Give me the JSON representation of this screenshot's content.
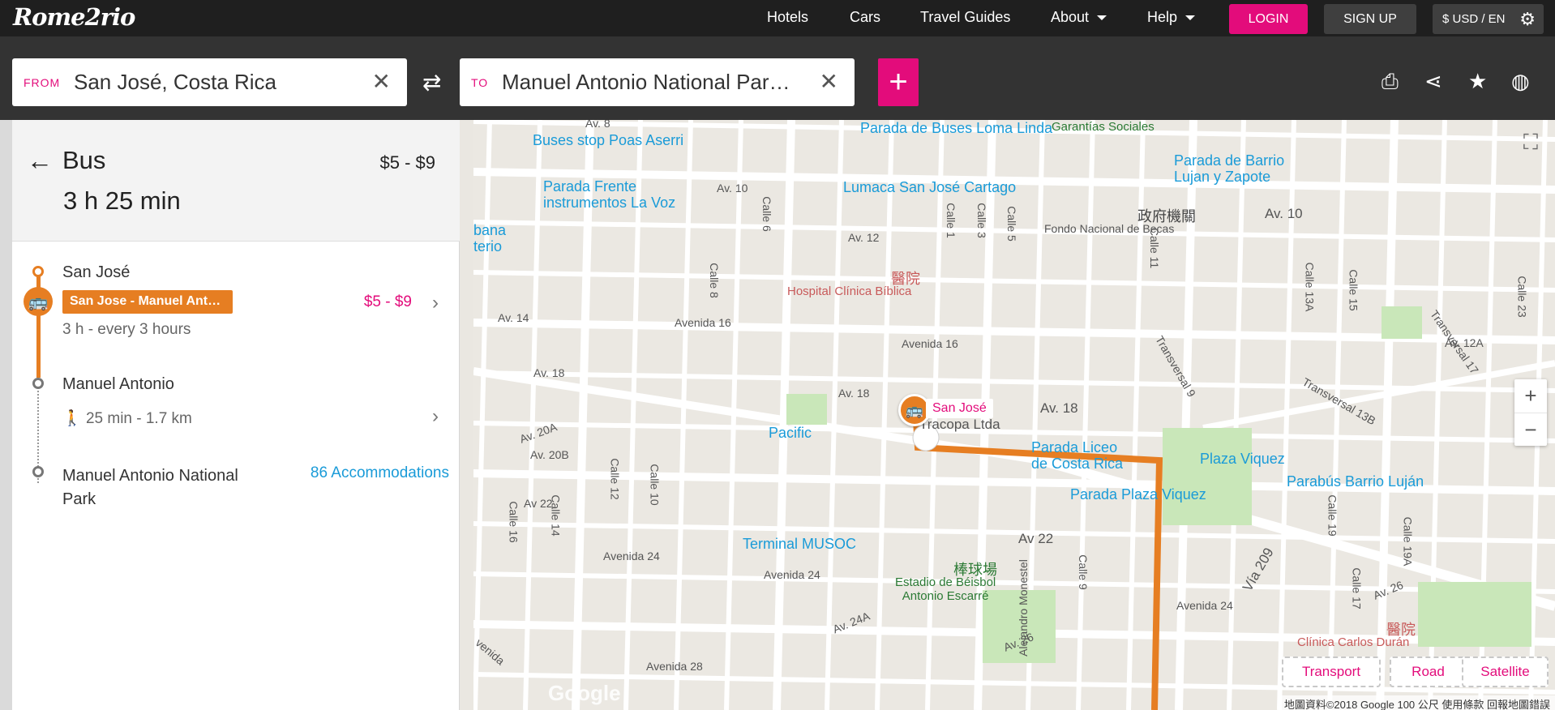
{
  "app": {
    "logo_text": "Rome2rio"
  },
  "nav": {
    "hotels": "Hotels",
    "cars": "Cars",
    "guides": "Travel Guides",
    "about": "About",
    "help": "Help",
    "login": "LOGIN",
    "signup": "SIGN UP",
    "currency": "$ USD / EN"
  },
  "search": {
    "from_label": "FROM",
    "from_value": "San José, Costa Rica",
    "to_label": "TO",
    "to_value": "Manuel Antonio National Park, Costa Rica"
  },
  "route": {
    "mode": "Bus",
    "price_range": "$5 - $9",
    "duration": "3 h 25 min",
    "stops": [
      {
        "name": "San José"
      },
      {
        "name": "Manuel Antonio"
      },
      {
        "name": "Manuel Antonio National Park"
      }
    ],
    "bus_leg": {
      "badge": "San Jose - Manuel Antonio",
      "price": "$5 - $9",
      "info": "3 h - every 3 hours"
    },
    "walk_leg": {
      "info": "25 min - 1.7 km"
    },
    "accommodations": "86 Accommodations"
  },
  "map": {
    "labels": {
      "parada_buses": "Parada de Buses\nLoma Linda",
      "buses_stop_poas": "Buses stop Poas Aserri",
      "parada_frente": "Parada Frente\ninstrumentos La Voz",
      "lumaca": "Lumaca San José Cartago",
      "parada_barrio": "Parada de Barrio\nLujan y Zapote",
      "pacific": "Pacific",
      "parada_liceo": "Parada Liceo\nde Costa Rica",
      "plaza_viquez": "Plaza Viquez",
      "parada_plaza": "Parada Plaza Viquez",
      "parabus": "Parabús Barrio Luján",
      "terminal_musoc": "Terminal MUSOC",
      "garantias": "Garantías Sociales",
      "fondo": "Fondo Nacional de Becas",
      "gobierno": "政府機關",
      "hospital_cjk": "醫院",
      "hospital": "Hospital Clínica Bíblica",
      "estadio_cjk": "棒球場",
      "estadio": "Estadio de Béisbol\nAntonio Escarré",
      "clinica_cjk": "醫院",
      "clinica": "Clínica Carlos Durán",
      "urbana": "bana\nterio",
      "tracopa": "Tracopa Ltda",
      "pin": "San José"
    },
    "streets": {
      "av8": "Av. 8",
      "av10a": "Av. 10",
      "av10b": "Av. 10",
      "av12": "Av. 12",
      "av14": "Av. 14",
      "avenida16a": "Avenida 16",
      "avenida16b": "Avenida 16",
      "av18a": "Av. 18",
      "av18b": "Av. 18",
      "av18c": "Av. 18",
      "av20a": "Av. 20A",
      "av20b": "Av. 20B",
      "av22a": "Av 22",
      "av22b": "Av 22",
      "avenida24a": "Avenida 24",
      "avenida24b": "Avenida 24",
      "avenida24c": "Avenida 24",
      "av24a": "Av. 24A",
      "av26": "Av. 26",
      "av26b": "Av. 26",
      "avenida28": "Avenida 28",
      "calle8": "Calle 8",
      "calle6": "Calle 6",
      "calle1": "Calle 1",
      "calle3": "Calle 3",
      "calle5": "Calle 5",
      "calle9": "Calle 9",
      "calle11": "Calle 11",
      "calle13a": "Calle 13A",
      "calle15": "Calle 15",
      "calle23": "Calle 23",
      "calle12": "Calle 12",
      "calle10": "Calle 10",
      "calle14": "Calle 14",
      "calle16": "Calle 16",
      "calle17": "Calle 17",
      "calle19": "Calle 19",
      "calle19a": "Calle 19A",
      "transversal9": "Transversal 9",
      "transversal13b": "Transversal 13B",
      "transversal17": "Transversal 17",
      "via209": "Vía 209",
      "av12a": "Av. 12A",
      "avenida": "venida",
      "alejandro": "Alejandro Monestel"
    },
    "toggles": {
      "transport": "Transport",
      "road": "Road",
      "satellite": "Satellite"
    },
    "attribution": "地圖資料©2018 Google   100 公尺         使用條款   回報地圖錯誤",
    "google": "Google",
    "zoom_in": "+",
    "zoom_out": "−"
  },
  "colors": {
    "brand_pink": "#e30c7b",
    "bus_orange": "#e67e22",
    "link_blue": "#1a9bd8"
  }
}
